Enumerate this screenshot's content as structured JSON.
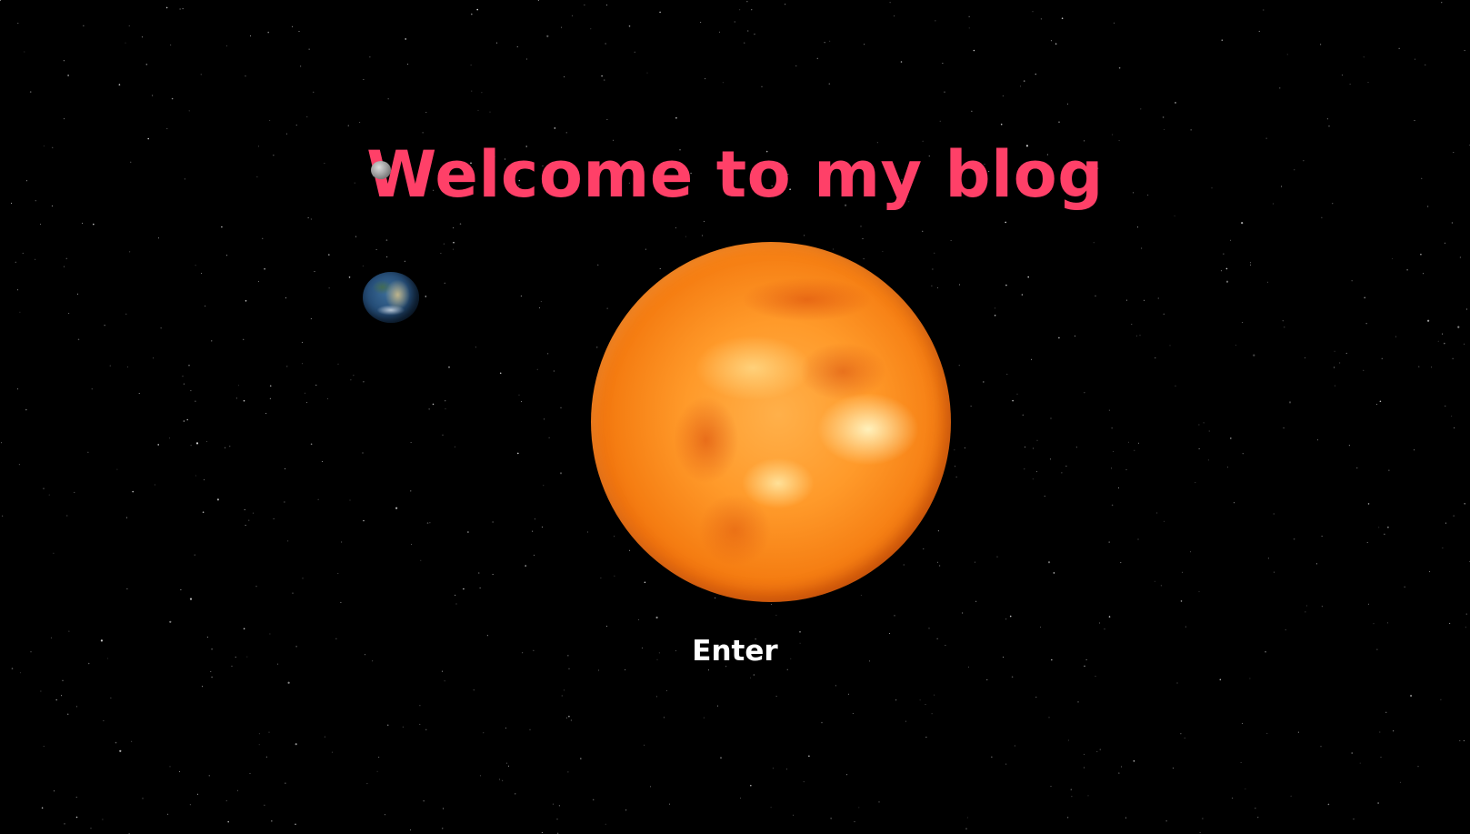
{
  "page": {
    "title": "Welcome to my blog",
    "enter_label": "Enter"
  },
  "scene": {
    "bodies": [
      {
        "name": "sun",
        "icon": "sun-icon"
      },
      {
        "name": "earth",
        "icon": "earth-icon"
      },
      {
        "name": "moon",
        "icon": "moon-icon"
      }
    ]
  },
  "colors": {
    "background": "#000000",
    "title": "#ff4068",
    "enter": "#ffffff",
    "stars": "#ffffff"
  }
}
